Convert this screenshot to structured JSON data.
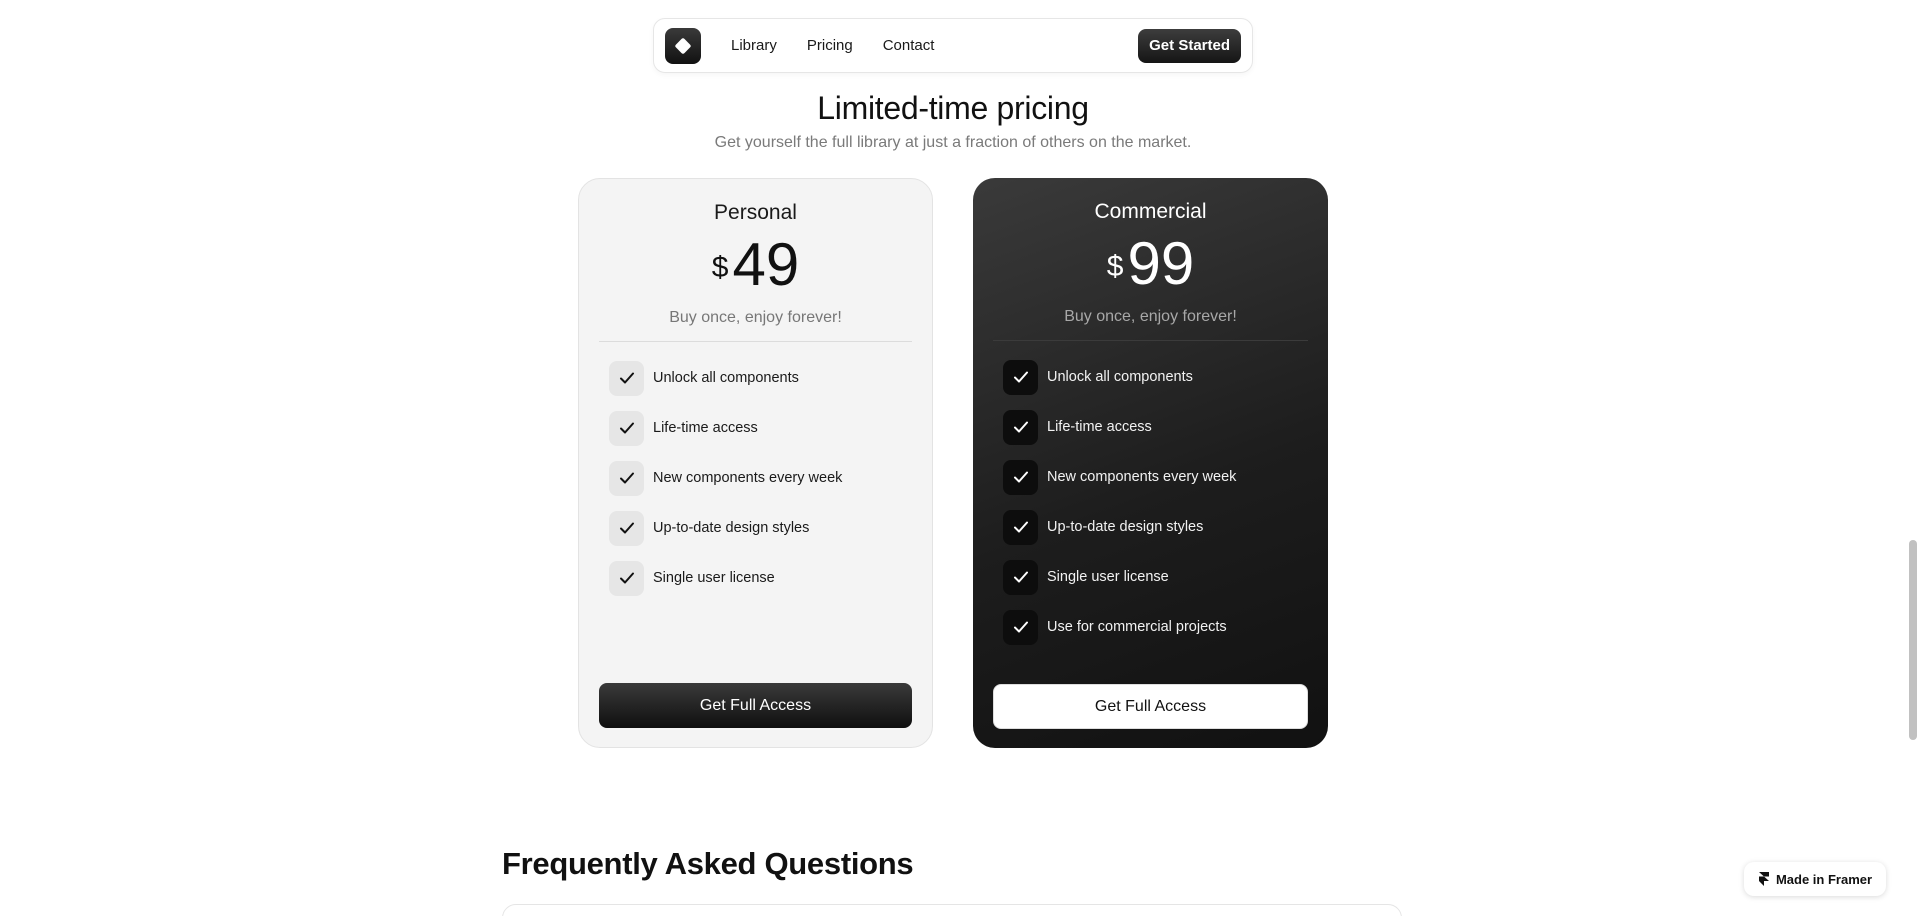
{
  "nav": {
    "links": [
      "Library",
      "Pricing",
      "Contact"
    ],
    "cta_label": "Get Started"
  },
  "section": {
    "title": "Limited-time pricing",
    "subtitle": "Get yourself the full library at just a fraction of others on the market."
  },
  "plans": [
    {
      "name": "Personal",
      "currency": "$",
      "price": "49",
      "tagline": "Buy once, enjoy forever!",
      "features": [
        "Unlock all components",
        "Life-time access",
        "New components every week",
        "Up-to-date design styles",
        "Single user license"
      ],
      "button_label": "Get Full Access"
    },
    {
      "name": "Commercial",
      "currency": "$",
      "price": "99",
      "tagline": "Buy once, enjoy forever!",
      "features": [
        "Unlock all components",
        "Life-time access",
        "New components every week",
        "Up-to-date design styles",
        "Single user license",
        "Use for commercial projects"
      ],
      "button_label": "Get Full Access"
    }
  ],
  "faq": {
    "title": "Frequently Asked Questions"
  },
  "badge": {
    "label": "Made in Framer"
  },
  "icons": {
    "logo": "diamond-logo-icon",
    "check": "check-icon",
    "framer": "framer-icon"
  },
  "colors": {
    "dark": "#111111",
    "light_card": "#f4f4f4",
    "muted_text": "#7a7a7a"
  }
}
